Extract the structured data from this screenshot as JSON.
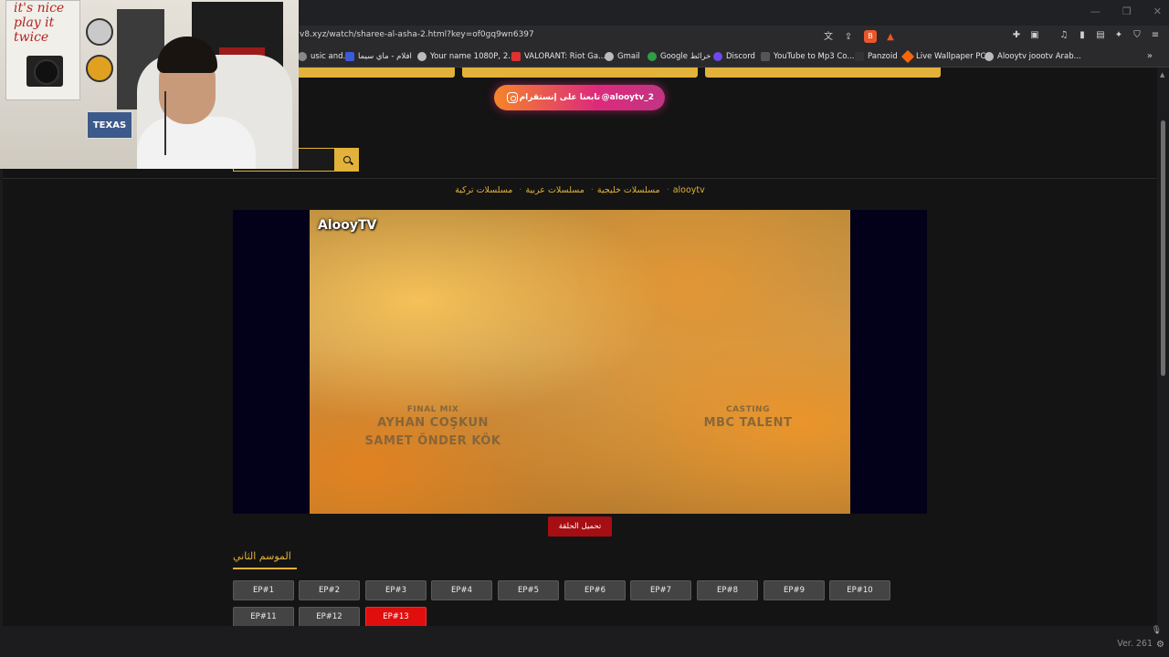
{
  "browser": {
    "url": "v8.xyz/watch/sharee-al-asha-2.html?key=of0gq9wn6397",
    "bookmarks": [
      {
        "label": "usic and...",
        "icon": "music-icon",
        "color": "#888888"
      },
      {
        "label": "افلام - ماي سيما",
        "icon": "mycima-icon",
        "color": "#3b5bdb"
      },
      {
        "label": "Your name 1080P, 2...",
        "icon": "globe-icon",
        "color": "#bbbbbb"
      },
      {
        "label": "VALORANT: Riot Ga...",
        "icon": "valorant-icon",
        "color": "#e03131"
      },
      {
        "label": "Gmail",
        "icon": "globe-icon",
        "color": "#bbbbbb"
      },
      {
        "label": "Google خرائط",
        "icon": "maps-icon",
        "color": "#2f9e44"
      },
      {
        "label": "Discord",
        "icon": "discord-icon",
        "color": "#7048e8"
      },
      {
        "label": "YouTube to Mp3 Co...",
        "icon": "yt-mp3-icon",
        "color": "#555555"
      },
      {
        "label": "Panzoid",
        "icon": "panzoid-icon",
        "color": "#333333"
      },
      {
        "label": "Live Wallpaper PC",
        "icon": "wallpaper-icon",
        "color": "#f76707"
      },
      {
        "label": "Alooytv joootv Arab...",
        "icon": "globe-icon",
        "color": "#bbbbbb"
      }
    ],
    "version": "Ver. 261"
  },
  "site": {
    "instagram_label": "تابعنا على إنستقرام",
    "instagram_handle": "@alooytv_2",
    "search_placeholder": "",
    "breadcrumbs": [
      "alooytv",
      "مسلسلات خليجية",
      "مسلسلات عربية",
      "مسلسلات تركية"
    ],
    "brand_color": "#e2b23a"
  },
  "player": {
    "watermark": "AlooyTV",
    "credit_left_role": "FINAL MIX",
    "credit_left_names": [
      "AYHAN COŞKUN",
      "SAMET ÖNDER KÖK"
    ],
    "credit_right_role": "CASTING",
    "credit_right_name": "MBC TALENT"
  },
  "download_label": "تحميل الحلقة",
  "season_title": "الموسم الثاني",
  "episodes": [
    "EP#1",
    "EP#2",
    "EP#3",
    "EP#4",
    "EP#5",
    "EP#6",
    "EP#7",
    "EP#8",
    "EP#9",
    "EP#10",
    "EP#11",
    "EP#12",
    "EP#13"
  ],
  "active_episode": "EP#13",
  "webcam": {
    "poster_text": "it's nice play it twice",
    "sign_text": "TEXAS"
  }
}
